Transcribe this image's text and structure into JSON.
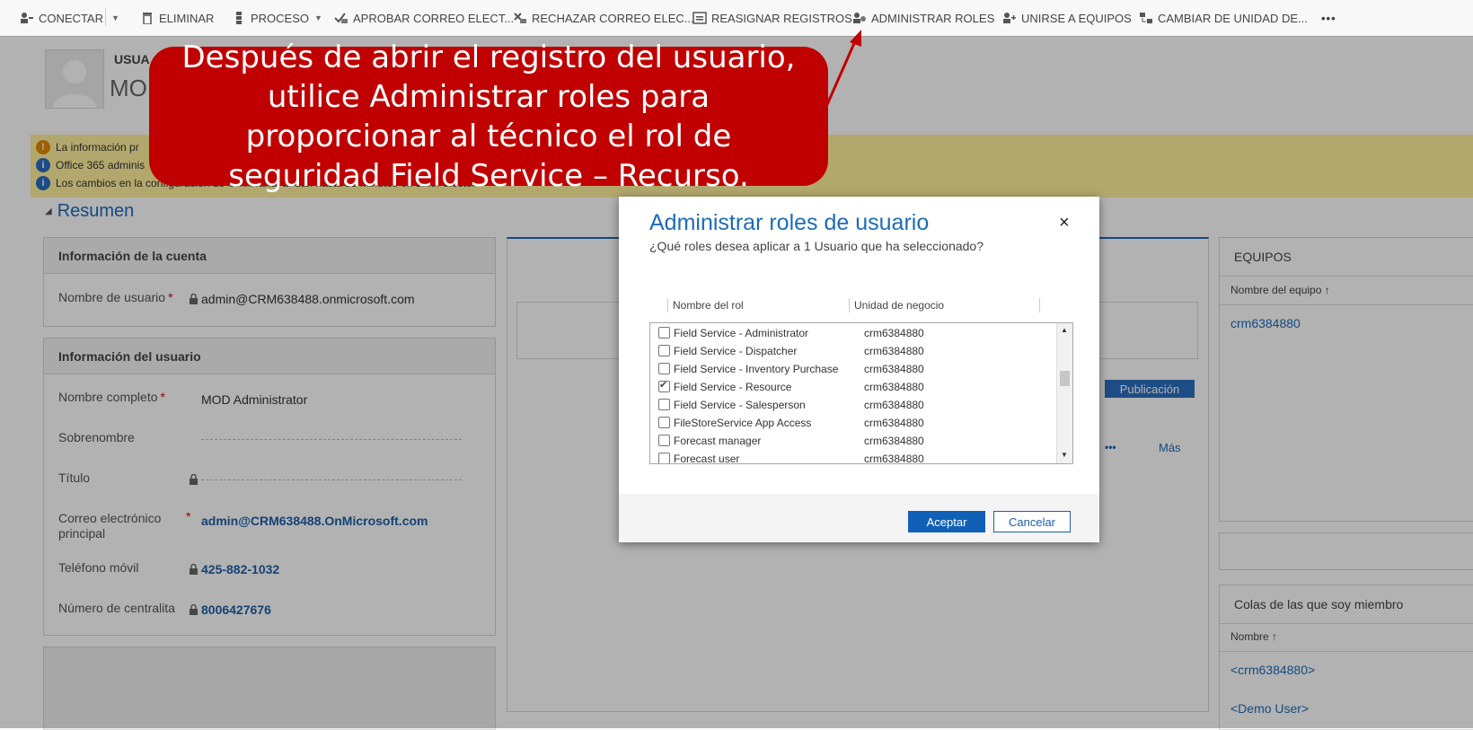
{
  "toolbar": {
    "items": [
      {
        "label": "CONECTAR",
        "icon": "connect-icon"
      },
      {
        "label": "ELIMINAR",
        "icon": "trash-icon"
      },
      {
        "label": "PROCESO",
        "icon": "process-icon"
      },
      {
        "label": "APROBAR CORREO ELECT...",
        "icon": "approve-email-icon"
      },
      {
        "label": "RECHAZAR CORREO ELEC...",
        "icon": "reject-email-icon"
      },
      {
        "label": "REASIGNAR REGISTROS",
        "icon": "reassign-icon"
      },
      {
        "label": "ADMINISTRAR ROLES",
        "icon": "manage-roles-icon"
      },
      {
        "label": "UNIRSE A EQUIPOS",
        "icon": "join-teams-icon"
      },
      {
        "label": "CAMBIAR DE UNIDAD DE...",
        "icon": "change-unit-icon"
      }
    ],
    "more": "•••"
  },
  "header": {
    "entity": "USUA",
    "name": "MOD"
  },
  "notifications": [
    {
      "type": "warning",
      "text": "La información pr"
    },
    {
      "type": "info",
      "text": "Office 365 adminis"
    },
    {
      "type": "info",
      "text": "Los cambios en la configuración de Omnicanal tardan hasta 15 minutos en surtir efecto."
    }
  ],
  "summary": {
    "label": "Resumen"
  },
  "account_section": {
    "title": "Información de la cuenta",
    "username_label": "Nombre de usuario",
    "username_value": "admin@CRM638488.onmicrosoft.com"
  },
  "user_section": {
    "title": "Información del usuario",
    "fullname_label": "Nombre completo",
    "fullname_value": "MOD Administrator",
    "nickname_label": "Sobrenombre",
    "title_label": "Título",
    "email_label": "Correo electrónico principal",
    "email_value": "admin@CRM638488.OnMicrosoft.com",
    "mobile_label": "Teléfono móvil",
    "mobile_value": "425-882-1032",
    "main_phone_label": "Número de centralita",
    "main_phone_value": "8006427676",
    "required_mark": "*"
  },
  "center": {
    "publish_label": "Publicación",
    "more_label": "Más",
    "dots": "•••"
  },
  "teams": {
    "title": "EQUIPOS",
    "column": "Nombre del equipo ↑",
    "items": [
      "crm6384880"
    ]
  },
  "queues": {
    "title": "Colas de las que soy miembro",
    "column": "Nombre ↑",
    "items": [
      "<crm6384880>",
      "<Demo User>"
    ]
  },
  "callout": {
    "text": "Después de abrir el registro del usuario, utilice Administrar roles para proporcionar al técnico el rol de seguridad Field Service – Recurso."
  },
  "dialog": {
    "title": "Administrar roles de usuario",
    "subtitle": "¿Qué roles desea aplicar a 1 Usuario que ha seleccionado?",
    "close": "×",
    "col_role": "Nombre del rol",
    "col_unit": "Unidad de negocio",
    "rows": [
      {
        "name": "Field Service - Administrator",
        "unit": "crm6384880",
        "checked": false
      },
      {
        "name": "Field Service - Dispatcher",
        "unit": "crm6384880",
        "checked": false
      },
      {
        "name": "Field Service - Inventory Purchase",
        "unit": "crm6384880",
        "checked": false
      },
      {
        "name": "Field Service - Resource",
        "unit": "crm6384880",
        "checked": true
      },
      {
        "name": "Field Service - Salesperson",
        "unit": "crm6384880",
        "checked": false
      },
      {
        "name": "FileStoreService App Access",
        "unit": "crm6384880",
        "checked": false
      },
      {
        "name": "Forecast manager",
        "unit": "crm6384880",
        "checked": false
      },
      {
        "name": "Forecast user",
        "unit": "crm6384880",
        "checked": false
      }
    ],
    "accept": "Aceptar",
    "cancel": "Cancelar"
  },
  "colors": {
    "accent": "#1e6bb8",
    "callout": "#c00000",
    "primary_button": "#1160b7",
    "notification": "#fff19d"
  }
}
